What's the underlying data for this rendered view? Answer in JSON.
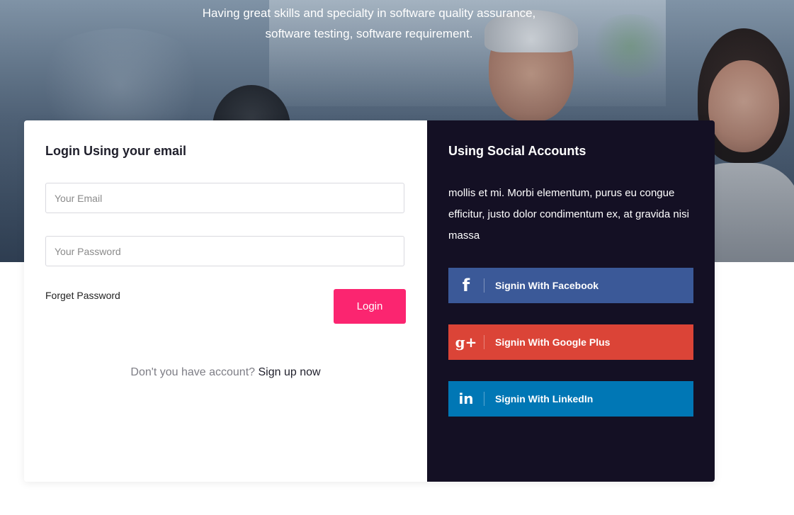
{
  "hero": {
    "tagline_line1": "Having great skills and specialty in software quality assurance,",
    "tagline_line2": "software testing, software requirement."
  },
  "login": {
    "title": "Login Using your email",
    "email_placeholder": "Your Email",
    "password_placeholder": "Your Password",
    "forget_password": "Forget Password",
    "login_button": "Login",
    "signup_prompt": "Don't you have account?",
    "signup_link": "Sign up now"
  },
  "social": {
    "title": "Using Social Accounts",
    "description": "mollis et mi. Morbi elementum, purus eu congue efficitur, justo dolor condimentum ex, at gravida nisi massa",
    "buttons": [
      {
        "label": "Signin With Facebook",
        "icon": "facebook-icon",
        "glyph": "f",
        "color": "#3b5998"
      },
      {
        "label": "Signin With Google Plus",
        "icon": "google-plus-icon",
        "glyph": "g+",
        "color": "#db4437"
      },
      {
        "label": "Signin With LinkedIn",
        "icon": "linkedin-icon",
        "glyph": "in",
        "color": "#0077b5"
      }
    ]
  },
  "colors": {
    "accent": "#fb2570",
    "social_panel_bg": "#141024"
  }
}
